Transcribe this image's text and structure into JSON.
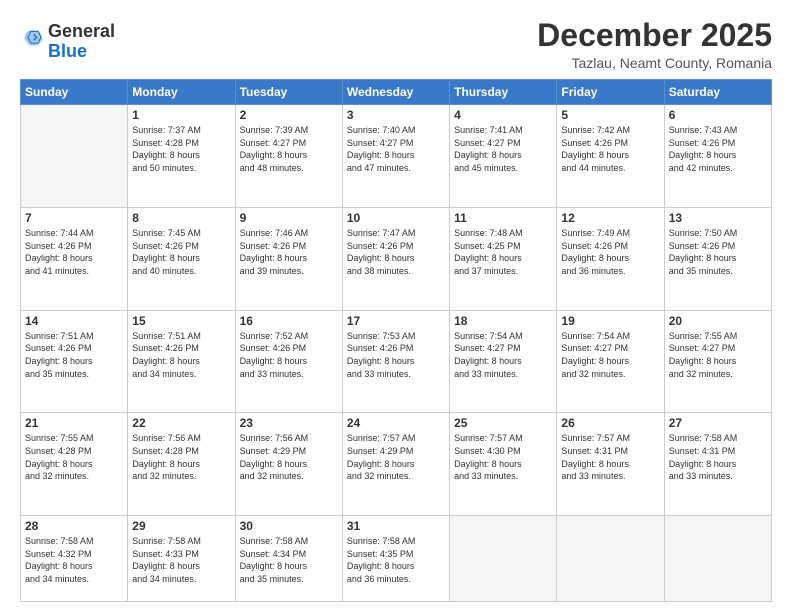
{
  "logo": {
    "general": "General",
    "blue": "Blue"
  },
  "header": {
    "month": "December 2025",
    "location": "Tazlau, Neamt County, Romania"
  },
  "weekdays": [
    "Sunday",
    "Monday",
    "Tuesday",
    "Wednesday",
    "Thursday",
    "Friday",
    "Saturday"
  ],
  "weeks": [
    [
      {
        "day": "",
        "info": ""
      },
      {
        "day": "1",
        "info": "Sunrise: 7:37 AM\nSunset: 4:28 PM\nDaylight: 8 hours\nand 50 minutes."
      },
      {
        "day": "2",
        "info": "Sunrise: 7:39 AM\nSunset: 4:27 PM\nDaylight: 8 hours\nand 48 minutes."
      },
      {
        "day": "3",
        "info": "Sunrise: 7:40 AM\nSunset: 4:27 PM\nDaylight: 8 hours\nand 47 minutes."
      },
      {
        "day": "4",
        "info": "Sunrise: 7:41 AM\nSunset: 4:27 PM\nDaylight: 8 hours\nand 45 minutes."
      },
      {
        "day": "5",
        "info": "Sunrise: 7:42 AM\nSunset: 4:26 PM\nDaylight: 8 hours\nand 44 minutes."
      },
      {
        "day": "6",
        "info": "Sunrise: 7:43 AM\nSunset: 4:26 PM\nDaylight: 8 hours\nand 42 minutes."
      }
    ],
    [
      {
        "day": "7",
        "info": "Sunrise: 7:44 AM\nSunset: 4:26 PM\nDaylight: 8 hours\nand 41 minutes."
      },
      {
        "day": "8",
        "info": "Sunrise: 7:45 AM\nSunset: 4:26 PM\nDaylight: 8 hours\nand 40 minutes."
      },
      {
        "day": "9",
        "info": "Sunrise: 7:46 AM\nSunset: 4:26 PM\nDaylight: 8 hours\nand 39 minutes."
      },
      {
        "day": "10",
        "info": "Sunrise: 7:47 AM\nSunset: 4:26 PM\nDaylight: 8 hours\nand 38 minutes."
      },
      {
        "day": "11",
        "info": "Sunrise: 7:48 AM\nSunset: 4:25 PM\nDaylight: 8 hours\nand 37 minutes."
      },
      {
        "day": "12",
        "info": "Sunrise: 7:49 AM\nSunset: 4:26 PM\nDaylight: 8 hours\nand 36 minutes."
      },
      {
        "day": "13",
        "info": "Sunrise: 7:50 AM\nSunset: 4:26 PM\nDaylight: 8 hours\nand 35 minutes."
      }
    ],
    [
      {
        "day": "14",
        "info": "Sunrise: 7:51 AM\nSunset: 4:26 PM\nDaylight: 8 hours\nand 35 minutes."
      },
      {
        "day": "15",
        "info": "Sunrise: 7:51 AM\nSunset: 4:26 PM\nDaylight: 8 hours\nand 34 minutes."
      },
      {
        "day": "16",
        "info": "Sunrise: 7:52 AM\nSunset: 4:26 PM\nDaylight: 8 hours\nand 33 minutes."
      },
      {
        "day": "17",
        "info": "Sunrise: 7:53 AM\nSunset: 4:26 PM\nDaylight: 8 hours\nand 33 minutes."
      },
      {
        "day": "18",
        "info": "Sunrise: 7:54 AM\nSunset: 4:27 PM\nDaylight: 8 hours\nand 33 minutes."
      },
      {
        "day": "19",
        "info": "Sunrise: 7:54 AM\nSunset: 4:27 PM\nDaylight: 8 hours\nand 32 minutes."
      },
      {
        "day": "20",
        "info": "Sunrise: 7:55 AM\nSunset: 4:27 PM\nDaylight: 8 hours\nand 32 minutes."
      }
    ],
    [
      {
        "day": "21",
        "info": "Sunrise: 7:55 AM\nSunset: 4:28 PM\nDaylight: 8 hours\nand 32 minutes."
      },
      {
        "day": "22",
        "info": "Sunrise: 7:56 AM\nSunset: 4:28 PM\nDaylight: 8 hours\nand 32 minutes."
      },
      {
        "day": "23",
        "info": "Sunrise: 7:56 AM\nSunset: 4:29 PM\nDaylight: 8 hours\nand 32 minutes."
      },
      {
        "day": "24",
        "info": "Sunrise: 7:57 AM\nSunset: 4:29 PM\nDaylight: 8 hours\nand 32 minutes."
      },
      {
        "day": "25",
        "info": "Sunrise: 7:57 AM\nSunset: 4:30 PM\nDaylight: 8 hours\nand 33 minutes."
      },
      {
        "day": "26",
        "info": "Sunrise: 7:57 AM\nSunset: 4:31 PM\nDaylight: 8 hours\nand 33 minutes."
      },
      {
        "day": "27",
        "info": "Sunrise: 7:58 AM\nSunset: 4:31 PM\nDaylight: 8 hours\nand 33 minutes."
      }
    ],
    [
      {
        "day": "28",
        "info": "Sunrise: 7:58 AM\nSunset: 4:32 PM\nDaylight: 8 hours\nand 34 minutes."
      },
      {
        "day": "29",
        "info": "Sunrise: 7:58 AM\nSunset: 4:33 PM\nDaylight: 8 hours\nand 34 minutes."
      },
      {
        "day": "30",
        "info": "Sunrise: 7:58 AM\nSunset: 4:34 PM\nDaylight: 8 hours\nand 35 minutes."
      },
      {
        "day": "31",
        "info": "Sunrise: 7:58 AM\nSunset: 4:35 PM\nDaylight: 8 hours\nand 36 minutes."
      },
      {
        "day": "",
        "info": ""
      },
      {
        "day": "",
        "info": ""
      },
      {
        "day": "",
        "info": ""
      }
    ]
  ]
}
